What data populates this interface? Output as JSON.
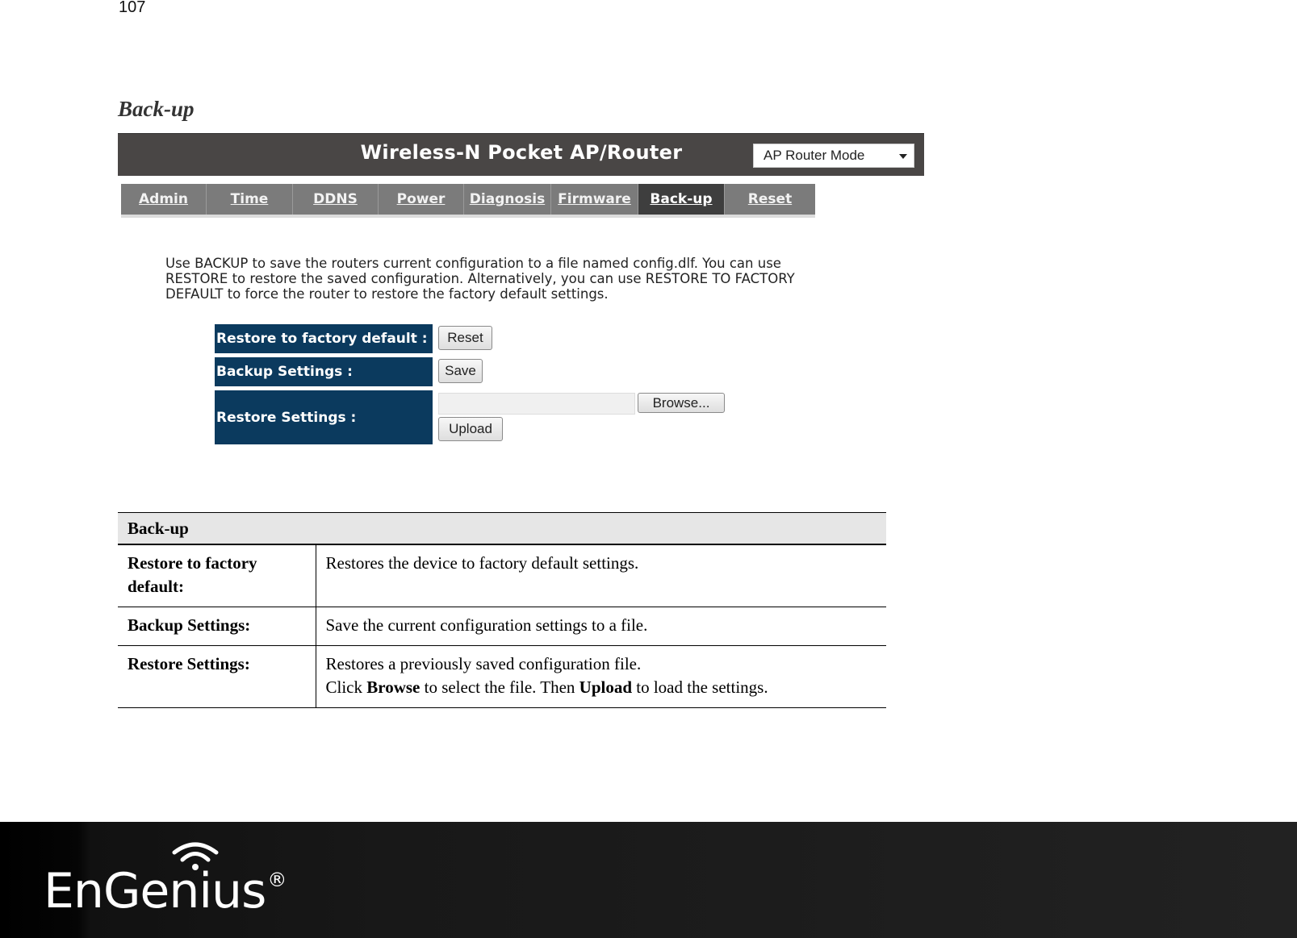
{
  "page": {
    "number": "107",
    "section_title": "Back-up"
  },
  "router_ui": {
    "title": "Wireless-N Pocket AP/Router",
    "mode_select": {
      "value": "AP Router Mode"
    },
    "nav_tabs": [
      {
        "label": "Admin",
        "active": false
      },
      {
        "label": "Time",
        "active": false
      },
      {
        "label": "DDNS",
        "active": false
      },
      {
        "label": "Power",
        "active": false
      },
      {
        "label": "Diagnosis",
        "active": false
      },
      {
        "label": "Firmware",
        "active": false
      },
      {
        "label": "Back-up",
        "active": true
      },
      {
        "label": "Reset",
        "active": false
      }
    ],
    "description": "Use BACKUP to save the routers current configuration to a file named config.dlf. You can use RESTORE to restore the saved configuration. Alternatively, you can use RESTORE TO FACTORY DEFAULT to force the router to restore the factory default settings.",
    "settings": {
      "restore_factory_label": "Restore to factory default :",
      "reset_button": "Reset",
      "backup_label": "Backup Settings :",
      "save_button": "Save",
      "restore_label": "Restore Settings :",
      "file_value": "",
      "browse_button": "Browse...",
      "upload_button": "Upload"
    }
  },
  "doc_table": {
    "header": "Back-up",
    "rows": [
      {
        "term": "Restore to factory default:",
        "desc": "Restores the device to factory default settings."
      },
      {
        "term": "Backup Settings:",
        "desc": "Save the current configuration settings to a file."
      },
      {
        "term": "Restore Settings:",
        "desc_line1": "Restores a previously saved configuration file.",
        "desc_click": "Click ",
        "desc_browse": "Browse",
        "desc_mid": " to select the file. Then ",
        "desc_upload": "Upload",
        "desc_end": " to load the settings."
      }
    ]
  },
  "footer": {
    "brand": "EnGenius",
    "registered": "®"
  }
}
